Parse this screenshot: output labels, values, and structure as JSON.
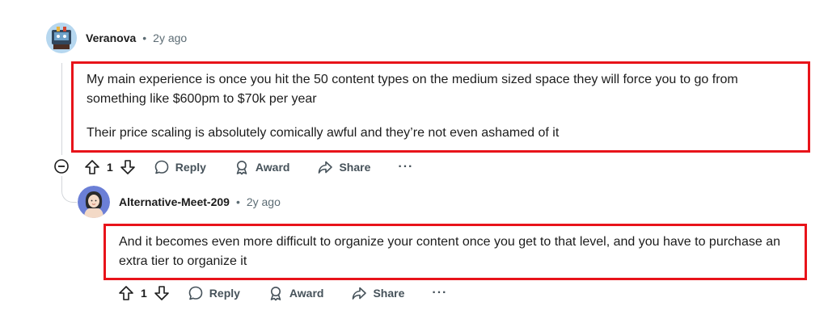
{
  "comments": [
    {
      "username": "Veranova",
      "separator": "•",
      "time": "2y ago",
      "paragraphs": [
        "My main experience is once you hit the 50 content types on the medium sized space they will force you to go from something like $600pm to $70k per year",
        "Their price scaling is absolutely comically awful and they’re not even ashamed of it"
      ],
      "vote_count": "1",
      "actions": {
        "reply": "Reply",
        "award": "Award",
        "share": "Share",
        "more": "···"
      },
      "highlight_color": "#e8131a"
    },
    {
      "username": "Alternative-Meet-209",
      "separator": "•",
      "time": "2y ago",
      "paragraphs": [
        "And it becomes even more difficult to organize your content once you get to that level, and you have to purchase an extra tier to organize it"
      ],
      "vote_count": "1",
      "actions": {
        "reply": "Reply",
        "award": "Award",
        "share": "Share",
        "more": "···"
      },
      "highlight_color": "#e8131a"
    }
  ],
  "icons": {
    "upvote": "upvote-icon",
    "downvote": "downvote-icon",
    "reply": "speech-bubble-icon",
    "award": "award-ribbon-icon",
    "share": "share-arrow-icon",
    "collapse": "collapse-minus-icon"
  }
}
